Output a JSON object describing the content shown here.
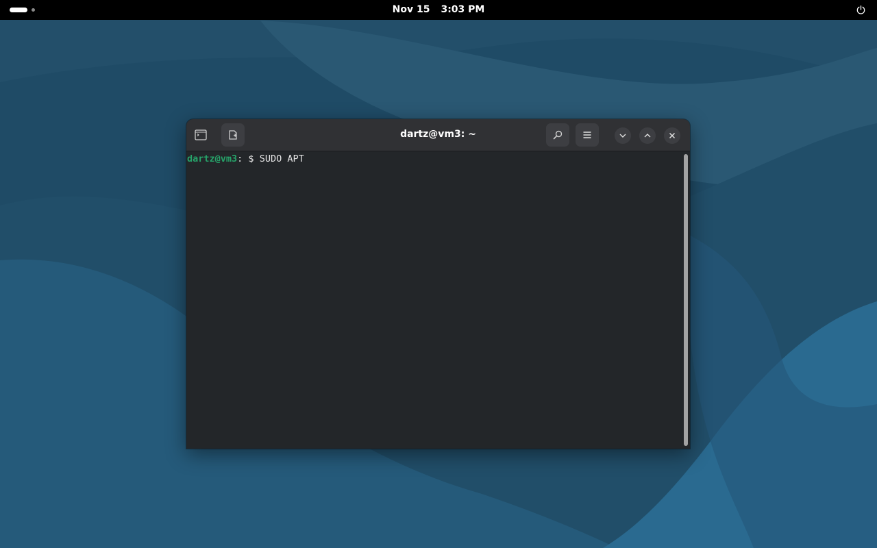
{
  "topbar": {
    "date": "Nov 15",
    "time": "3:03 PM",
    "icons": [
      "workspace-indicator",
      "power-icon"
    ]
  },
  "window": {
    "title": "dartz@vm3: ~",
    "icons": [
      "terminal-icon",
      "new-tab-icon",
      "search-icon",
      "menu-icon",
      "minimize-icon",
      "maximize-icon",
      "close-icon"
    ]
  },
  "terminal": {
    "user_host": "dartz@vm3",
    "separator": ":",
    "prompt_symbol": " $ ",
    "command": "SUDO APT"
  },
  "colors": {
    "topbar_bg": "#000000",
    "wallpaper_base": "#1e4a64",
    "terminal_bg": "#232629",
    "headerbar_bg": "#303134",
    "prompt_user": "#26a269",
    "text": "#e6e6e6"
  }
}
